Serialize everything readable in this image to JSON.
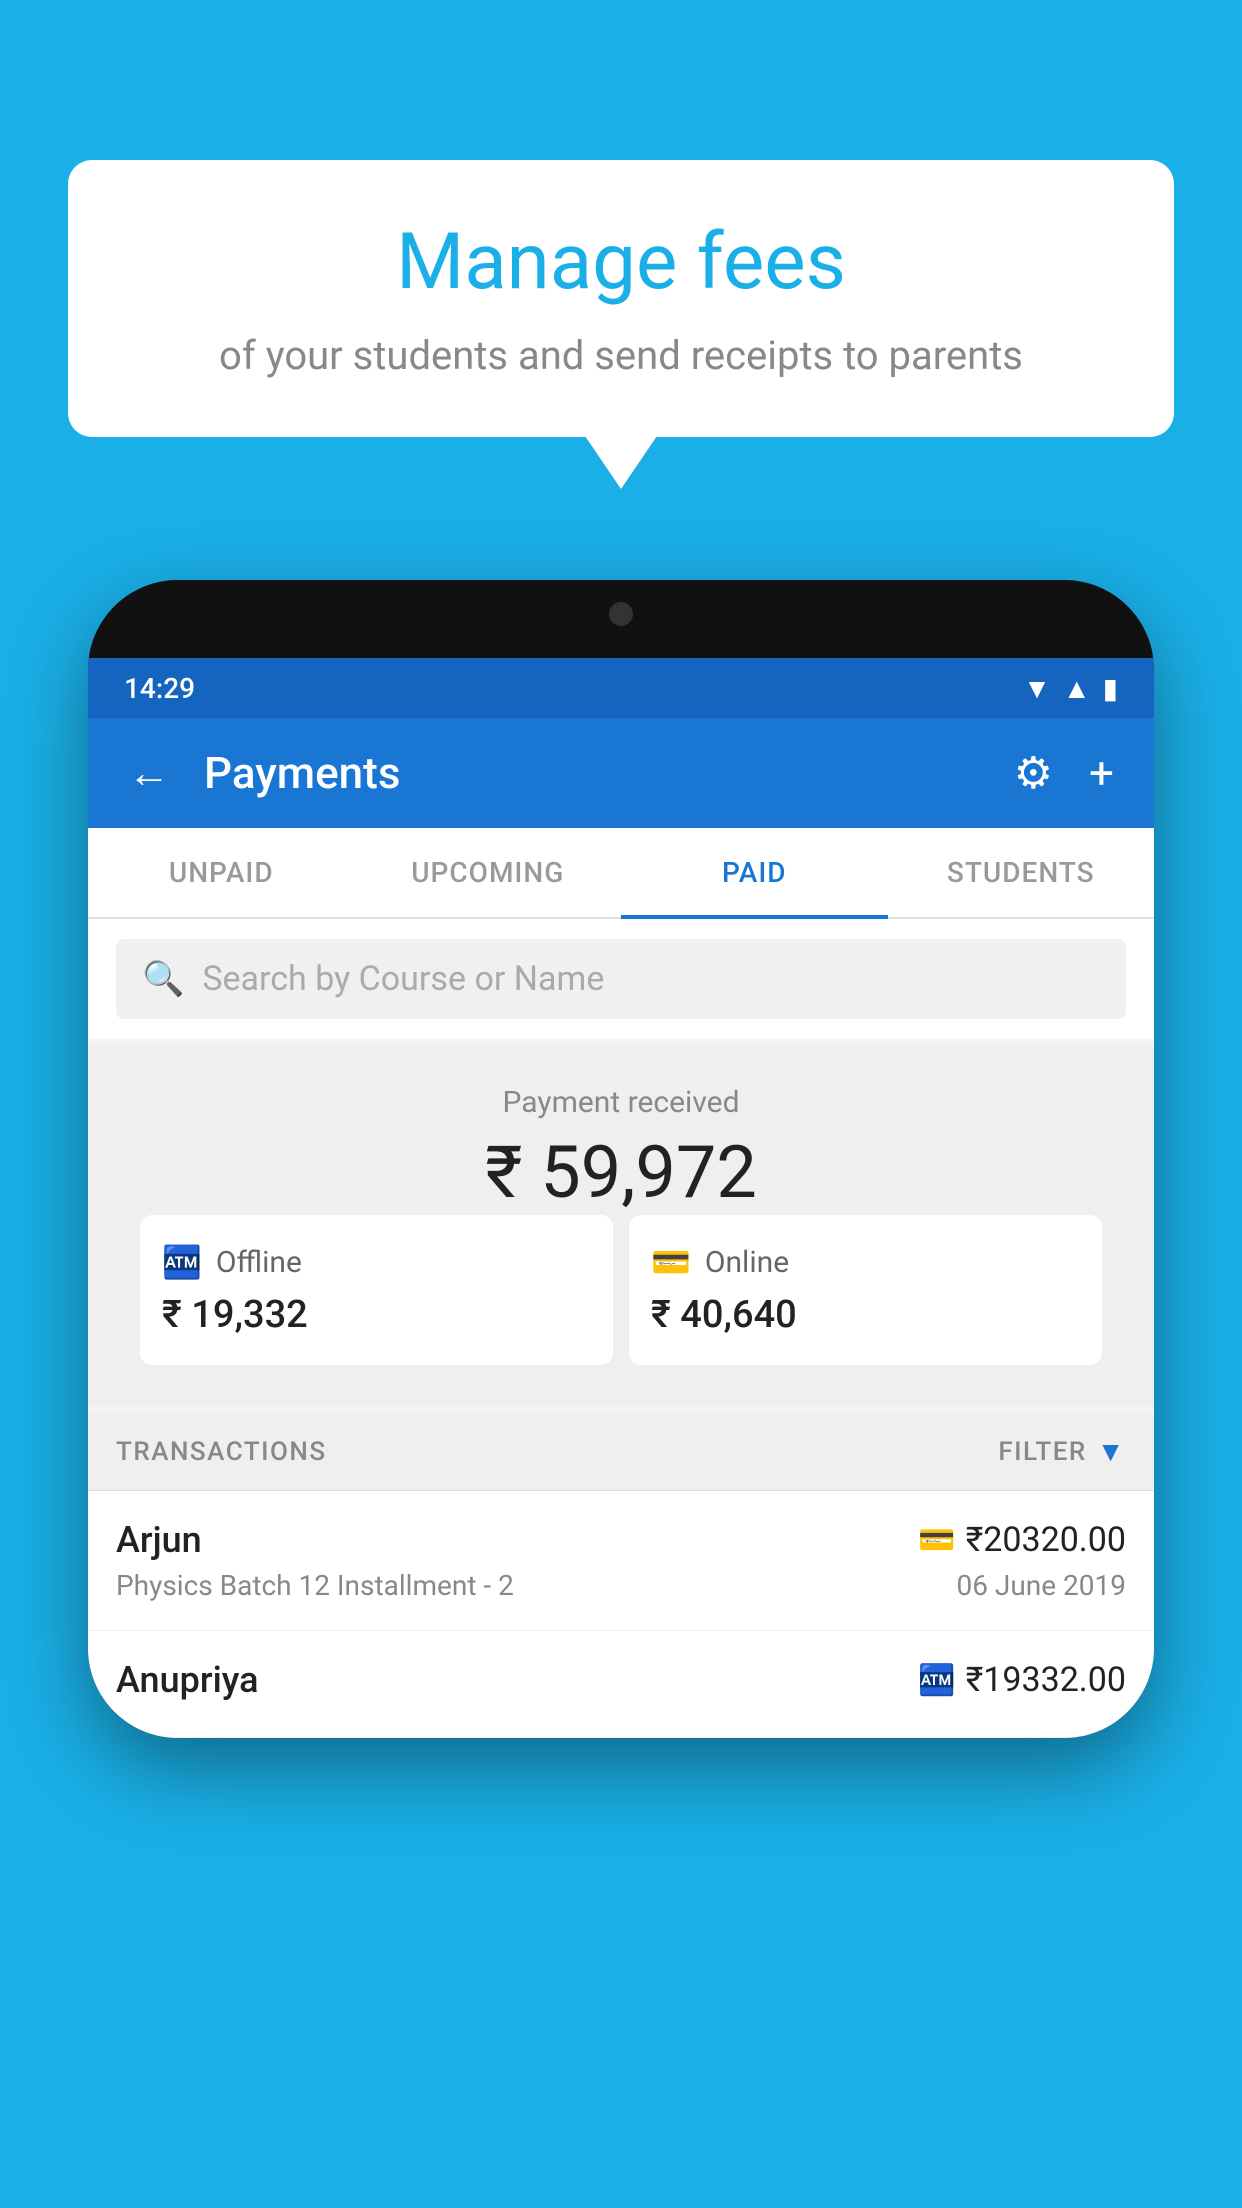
{
  "background_color": "#1aafe6",
  "bubble": {
    "title": "Manage fees",
    "subtitle": "of your students and send receipts to parents"
  },
  "status_bar": {
    "time": "14:29"
  },
  "app_bar": {
    "title": "Payments",
    "back_label": "←",
    "gear_label": "⚙",
    "plus_label": "+"
  },
  "tabs": [
    {
      "label": "UNPAID",
      "active": false
    },
    {
      "label": "UPCOMING",
      "active": false
    },
    {
      "label": "PAID",
      "active": true
    },
    {
      "label": "STUDENTS",
      "active": false
    }
  ],
  "search": {
    "placeholder": "Search by Course or Name"
  },
  "payment_summary": {
    "label": "Payment received",
    "amount": "₹ 59,972",
    "offline_label": "Offline",
    "offline_amount": "₹ 19,332",
    "online_label": "Online",
    "online_amount": "₹ 40,640"
  },
  "transactions": {
    "header_label": "TRANSACTIONS",
    "filter_label": "FILTER",
    "items": [
      {
        "name": "Arjun",
        "course": "Physics Batch 12 Installment - 2",
        "amount": "₹20320.00",
        "date": "06 June 2019",
        "payment_type": "card"
      },
      {
        "name": "Anupriya",
        "course": "",
        "amount": "₹19332.00",
        "date": "",
        "payment_type": "cash"
      }
    ]
  }
}
